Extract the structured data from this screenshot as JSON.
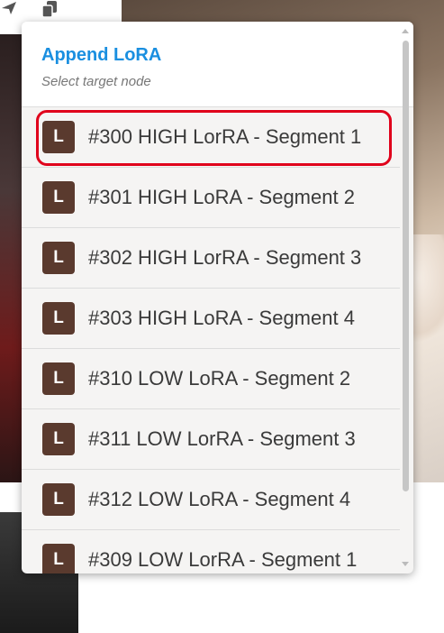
{
  "panel": {
    "title": "Append LoRA",
    "subtitle": "Select target node"
  },
  "items": [
    {
      "badge": "L",
      "label": "#300 HIGH LorRA - Segment 1"
    },
    {
      "badge": "L",
      "label": "#301 HIGH LoRA - Segment 2"
    },
    {
      "badge": "L",
      "label": "#302 HIGH LorRA - Segment 3"
    },
    {
      "badge": "L",
      "label": "#303 HIGH LoRA - Segment 4"
    },
    {
      "badge": "L",
      "label": "#310 LOW LoRA - Segment 2"
    },
    {
      "badge": "L",
      "label": "#311 LOW LorRA - Segment 3"
    },
    {
      "badge": "L",
      "label": "#312 LOW LoRA - Segment 4"
    },
    {
      "badge": "L",
      "label": "#309 LOW LorRA - Segment 1"
    }
  ],
  "colors": {
    "title": "#1a8fe0",
    "badge": "#5a3a2e",
    "highlight": "#e0001b"
  },
  "icons": {
    "toolbar": [
      "send-icon",
      "copy-icon"
    ]
  }
}
